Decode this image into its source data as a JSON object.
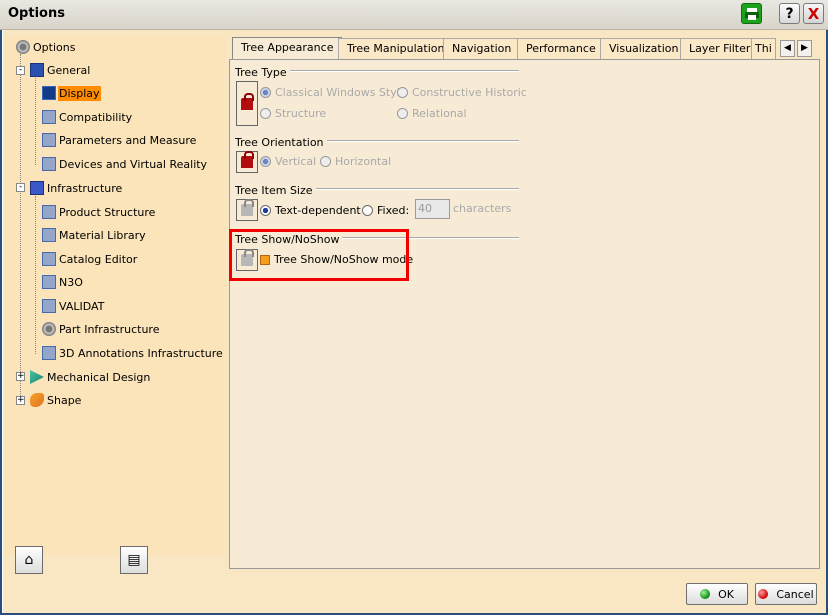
{
  "window": {
    "title": "Options",
    "help_label": "?",
    "close_label": "X"
  },
  "tree": {
    "items": [
      {
        "label": "Options"
      },
      {
        "label": "General"
      },
      {
        "label": "Display"
      },
      {
        "label": "Compatibility"
      },
      {
        "label": "Parameters and Measure"
      },
      {
        "label": "Devices and Virtual Reality"
      },
      {
        "label": "Infrastructure"
      },
      {
        "label": "Product Structure"
      },
      {
        "label": "Material Library"
      },
      {
        "label": "Catalog Editor"
      },
      {
        "label": "N3O"
      },
      {
        "label": "VALIDAT"
      },
      {
        "label": "Part Infrastructure"
      },
      {
        "label": "3D Annotations Infrastructure"
      },
      {
        "label": "Mechanical Design"
      },
      {
        "label": "Shape"
      }
    ],
    "selected": "Display"
  },
  "tabs": [
    {
      "label": "Tree Appearance",
      "active": true
    },
    {
      "label": "Tree Manipulation"
    },
    {
      "label": "Navigation"
    },
    {
      "label": "Performance"
    },
    {
      "label": "Visualization"
    },
    {
      "label": "Layer Filter"
    },
    {
      "label": "Thi"
    }
  ],
  "tree_type": {
    "title": "Tree Type",
    "options": [
      "Classical Windows Style",
      "Constructive Historic",
      "Structure",
      "Relational"
    ]
  },
  "tree_orientation": {
    "title": "Tree Orientation",
    "options": [
      "Vertical",
      "Horizontal"
    ]
  },
  "tree_item_size": {
    "title": "Tree Item Size",
    "text_dependent": "Text-dependent",
    "fixed": "Fixed:",
    "value": "40",
    "unit": "characters"
  },
  "tree_shownoshow": {
    "title": "Tree Show/NoShow",
    "mode_label": "Tree Show/NoShow mode"
  },
  "buttons": {
    "ok": "OK",
    "cancel": "Cancel"
  }
}
